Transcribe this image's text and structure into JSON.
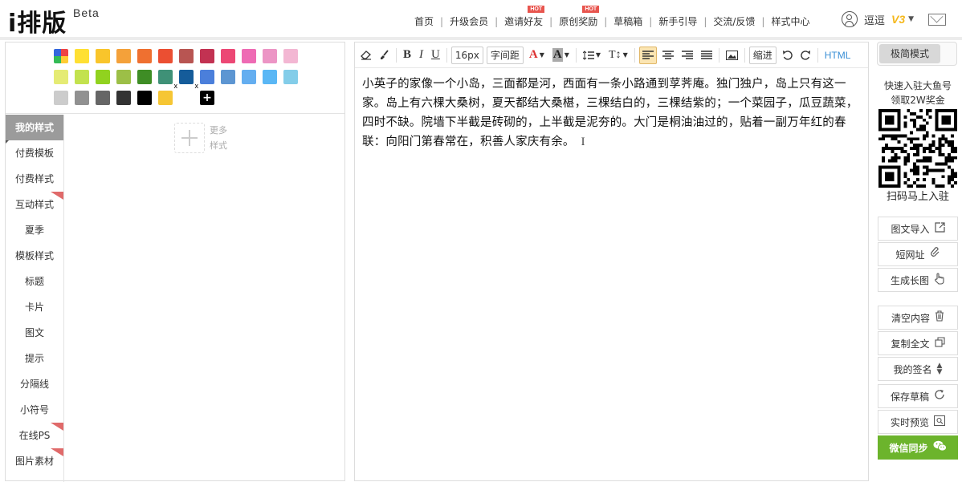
{
  "brand": {
    "logo": "i排版",
    "beta": "Beta"
  },
  "nav": [
    {
      "label": "首页",
      "hot": false
    },
    {
      "label": "升级会员",
      "hot": false
    },
    {
      "label": "邀请好友",
      "hot": true
    },
    {
      "label": "原创奖励",
      "hot": true
    },
    {
      "label": "草稿箱",
      "hot": false
    },
    {
      "label": "新手引导",
      "hot": false
    },
    {
      "label": "交流/反馈",
      "hot": false
    },
    {
      "label": "样式中心",
      "hot": false
    }
  ],
  "hot_label": "HOT",
  "user": {
    "name": "逗逗",
    "vip": "V3"
  },
  "palette": {
    "row1": [
      "rainbow",
      "#ffe033",
      "#f9c52b",
      "#f4a13a",
      "#ef7030",
      "#eb4f32",
      "#b85552",
      "#c23252",
      "#ec4875",
      "#ee6bb4",
      "#ec95c5",
      "#f3b7d3"
    ],
    "row2": [
      "#e5eb74",
      "#c3e24e",
      "#91d21f",
      "#9cbf47",
      "#3e8d25",
      "#3f9177",
      "#155c9a",
      "#4b7fdb",
      "#5d96d2",
      "#64aef0",
      "#5ab7f5",
      "#83cde9"
    ],
    "row3": [
      "#cccccc",
      "#919191",
      "#666666",
      "#333333",
      "#000000",
      "#f6c634",
      "#ffffff",
      "plus"
    ]
  },
  "categories": [
    {
      "label": "我的样式",
      "active": true,
      "ribbon": false
    },
    {
      "label": "付费模板",
      "active": false,
      "ribbon": false
    },
    {
      "label": "付费样式",
      "active": false,
      "ribbon": false
    },
    {
      "label": "互动样式",
      "active": false,
      "ribbon": true
    },
    {
      "label": "夏季",
      "active": false,
      "ribbon": false
    },
    {
      "label": "模板样式",
      "active": false,
      "ribbon": false
    },
    {
      "label": "标题",
      "active": false,
      "ribbon": false
    },
    {
      "label": "卡片",
      "active": false,
      "ribbon": false
    },
    {
      "label": "图文",
      "active": false,
      "ribbon": false
    },
    {
      "label": "提示",
      "active": false,
      "ribbon": false
    },
    {
      "label": "分隔线",
      "active": false,
      "ribbon": false
    },
    {
      "label": "小符号",
      "active": false,
      "ribbon": false
    },
    {
      "label": "在线PS",
      "active": false,
      "ribbon": true
    },
    {
      "label": "图片素材",
      "active": false,
      "ribbon": true
    }
  ],
  "more_styles": "更多样式",
  "toolbar": {
    "font_size": "16px",
    "letter_spacing": "字间距",
    "indent": "缩进",
    "html": "HTML"
  },
  "editor": {
    "content": "小英子的家像一个小岛，三面都是河，西面有一条小路通到莩荠庵。独门独户，岛上只有这一家。岛上有六棵大桑树，夏天都结大桑椹，三棵结白的，三棵结紫的；一个菜园子，瓜豆蔬菜，四时不缺。院墙下半截是砖砌的，上半截是泥夯的。大门是桐油油过的，贴着一副万年红的春联：向阳门第春常在，积善人家庆有余。"
  },
  "sidebar": {
    "mode": "极简模式",
    "promo_line1": "快速入驻大鱼号",
    "promo_line2": "领取2W奖金",
    "scan": "扫码马上入驻",
    "buttons": [
      {
        "label": "图文导入",
        "icon": "import-icon"
      },
      {
        "label": "短网址",
        "icon": "link-icon"
      },
      {
        "label": "生成长图",
        "icon": "hand-icon"
      },
      {
        "label": "清空内容",
        "icon": "trash-icon"
      },
      {
        "label": "复制全文",
        "icon": "copy-icon"
      },
      {
        "label": "我的签名",
        "icon": "sort-icon"
      },
      {
        "label": "保存草稿",
        "icon": "refresh-icon"
      },
      {
        "label": "实时预览",
        "icon": "preview-icon"
      },
      {
        "label": "微信同步",
        "icon": "wechat-icon"
      }
    ]
  }
}
